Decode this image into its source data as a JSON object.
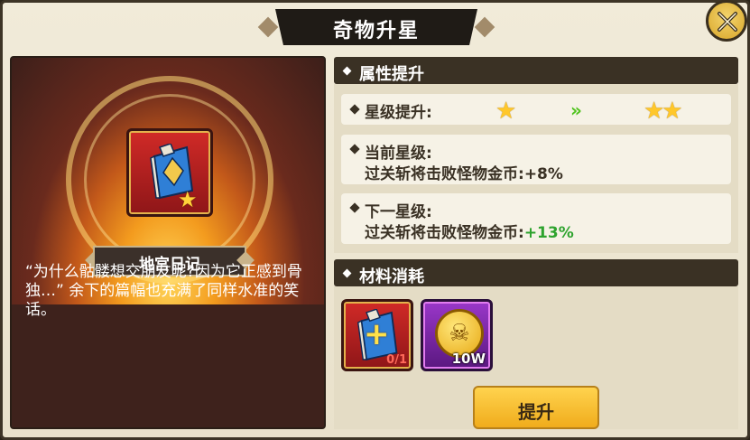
{
  "title": "奇物升星",
  "close_icon": "crossed-swords-icon",
  "item": {
    "name": "地宫日记",
    "icon": "book-icon",
    "star": "★",
    "quote": "“为什么骷髅想交朋友呢?因为它正感到骨独…” 余下的篇幅也充满了同样水准的笑话。"
  },
  "attributes": {
    "header": "属性提升",
    "star_upgrade_label": "星级提升:",
    "current_stars": "★",
    "arrow": "»",
    "next_stars": "★★",
    "current": {
      "label": "当前星级:",
      "stat": "过关斩将击败怪物金币:",
      "value": "+8%"
    },
    "next": {
      "label": "下一星级:",
      "stat": "过关斩将击败怪物金币:",
      "value": "+13%"
    }
  },
  "materials": {
    "header": "材料消耗",
    "items": [
      {
        "icon": "book-plus-icon",
        "count": "0/1"
      },
      {
        "icon": "skull-coin-icon",
        "count": "10W"
      }
    ]
  },
  "upgrade_button": "提升",
  "colors": {
    "accent_gold": "#f0ac1c",
    "green_value": "#2ea32e",
    "header_dark": "#3a3124"
  }
}
